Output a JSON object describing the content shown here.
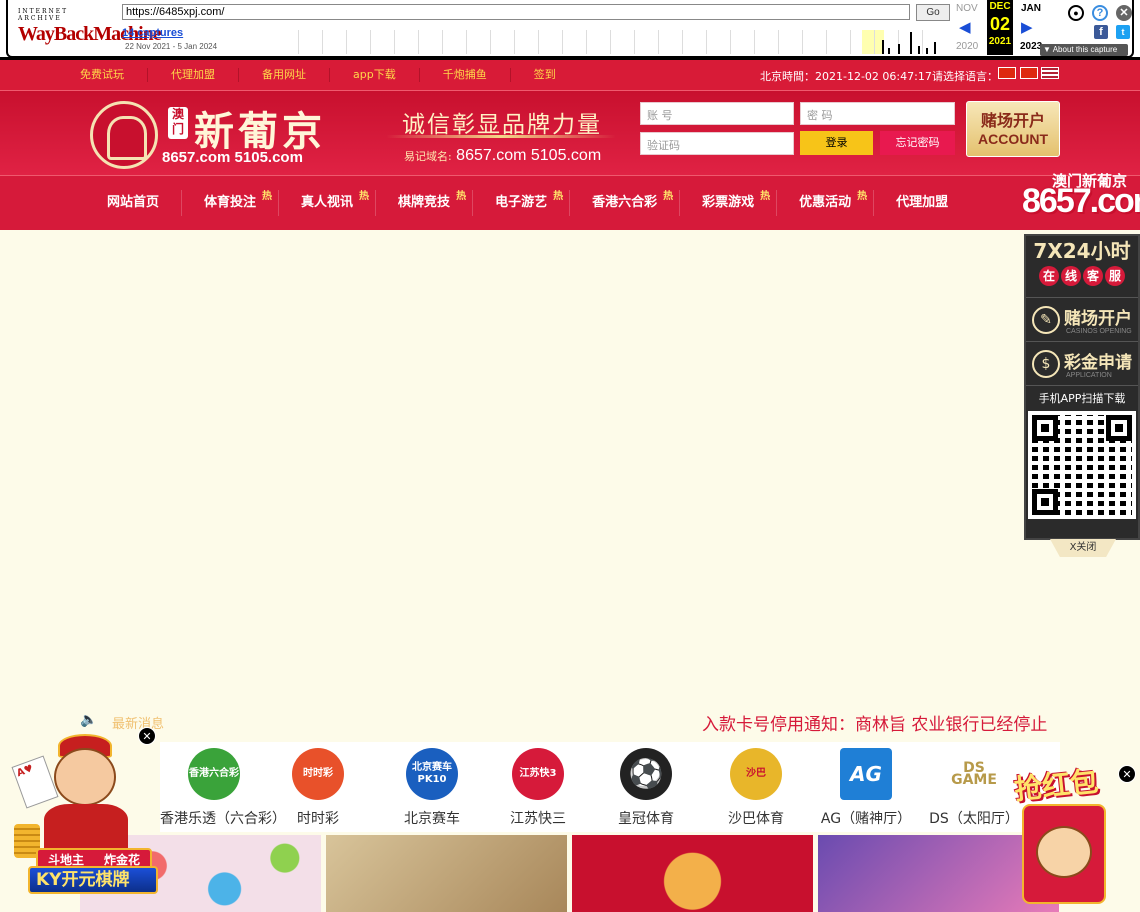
{
  "wayback": {
    "logo_top": "INTERNET ARCHIVE",
    "logo_main": "WayBackMachine",
    "url": "https://6485xpj.com/",
    "go_label": "Go",
    "captures": "14 captures",
    "date_range": "22 Nov 2021 - 5 Jan 2024",
    "prev_month": "NOV",
    "cur_month": "DEC",
    "cur_day": "02",
    "cur_year": "2021",
    "next_month": "JAN",
    "prev_year": "2020",
    "next_year": "2023",
    "about": "About this capture",
    "prev_arrow": "◀",
    "next_arrow": "▶"
  },
  "topbar": {
    "links": [
      "免费试玩",
      "代理加盟",
      "备用网址",
      "app下载",
      "千炮捕鱼",
      "签到"
    ],
    "clock_label": "北京時間：",
    "clock_value": "2021-12-02 06:47:17",
    "lang_label": "请选择语言："
  },
  "header": {
    "macau": "澳门",
    "title": "新葡京",
    "domains": "8657.com 5105.com",
    "slogan": "诚信彰显品牌力量",
    "remember_label": "易记域名:",
    "remember_domains": " 8657.com 5105.com",
    "account_placeholder": "账 号",
    "password_placeholder": "密 码",
    "captcha_placeholder": "验证码",
    "login": "登录",
    "forgot": "忘记密码",
    "open_account_cn": "赌场开户",
    "open_account_en": "ACCOUNT"
  },
  "nav": {
    "items": [
      {
        "label": "网站首页",
        "hot": ""
      },
      {
        "label": "体育投注",
        "hot": "热"
      },
      {
        "label": "真人视讯",
        "hot": "热"
      },
      {
        "label": "棋牌竞技",
        "hot": "热"
      },
      {
        "label": "电子游艺",
        "hot": "热"
      },
      {
        "label": "香港六合彩",
        "hot": "热"
      },
      {
        "label": "彩票游戏",
        "hot": "热"
      },
      {
        "label": "优惠活动",
        "hot": "热"
      },
      {
        "label": "代理加盟",
        "hot": ""
      }
    ]
  },
  "news": {
    "label": "最新消息",
    "marquee": "入款卡号停用通知：商林旨 农业银行已经停止"
  },
  "games": [
    {
      "label": "香港乐透（六合彩）",
      "icon_text": "香港六合彩",
      "color": "#3aa33a"
    },
    {
      "label": "时时彩",
      "icon_text": "时时彩",
      "color": "#e8512a"
    },
    {
      "label": "北京赛车",
      "icon_text": "北京赛车 PK10",
      "color": "#1a5fbf"
    },
    {
      "label": "江苏快三",
      "icon_text": "江苏快3",
      "color": "#d61a3a"
    },
    {
      "label": "皇冠体育",
      "icon_text": "⚽",
      "color": "#222222"
    },
    {
      "label": "沙巴体育",
      "icon_text": "沙巴",
      "color": "#e8b62a"
    },
    {
      "label": "AG（赌神厅）",
      "icon_text": "AG",
      "color": "#1f7fd6"
    },
    {
      "label": "DS（太阳厅）",
      "icon_text": "DS GAME",
      "color": "#b79a4a"
    }
  ],
  "side": {
    "brand_cn": "澳门新葡京",
    "brand_num": "8657.com",
    "service_title": "7X24小时",
    "service_chars": [
      "在",
      "线",
      "客",
      "服"
    ],
    "open_account": "赌场开户",
    "open_account_en": "CASINOS OPENING",
    "bonus": "彩金申请",
    "bonus_en": "APPLICATION",
    "qr_label": "手机APP扫描下载",
    "close": "X关闭"
  },
  "float_left": {
    "tag1": "斗地主",
    "tag2": "炸金花",
    "brand": "KY开元棋牌",
    "close": "✕"
  },
  "float_right": {
    "title": "抢红包",
    "close": "✕"
  },
  "colors": {
    "primary_red": "#d61a3a",
    "gold": "#f7c418",
    "background": "#fdfbe9"
  }
}
